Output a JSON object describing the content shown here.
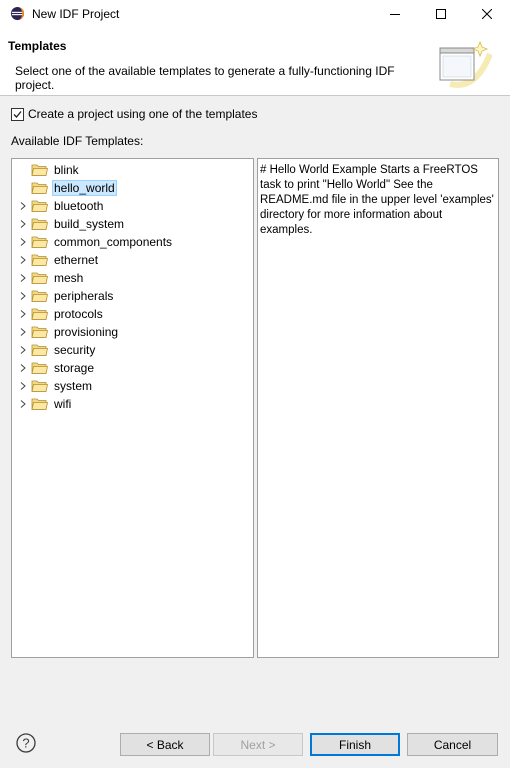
{
  "window": {
    "title": "New IDF Project"
  },
  "header": {
    "title": "Templates",
    "description": "Select one of the available templates to generate a fully-functioning IDF project."
  },
  "checkbox": {
    "label": "Create a project using one of the templates",
    "checked": true
  },
  "available_label": "Available IDF Templates:",
  "tree": {
    "items": [
      {
        "label": "blink",
        "expandable": false,
        "selected": false
      },
      {
        "label": "hello_world",
        "expandable": false,
        "selected": true
      },
      {
        "label": "bluetooth",
        "expandable": true,
        "selected": false
      },
      {
        "label": "build_system",
        "expandable": true,
        "selected": false
      },
      {
        "label": "common_components",
        "expandable": true,
        "selected": false
      },
      {
        "label": "ethernet",
        "expandable": true,
        "selected": false
      },
      {
        "label": "mesh",
        "expandable": true,
        "selected": false
      },
      {
        "label": "peripherals",
        "expandable": true,
        "selected": false
      },
      {
        "label": "protocols",
        "expandable": true,
        "selected": false
      },
      {
        "label": "provisioning",
        "expandable": true,
        "selected": false
      },
      {
        "label": "security",
        "expandable": true,
        "selected": false
      },
      {
        "label": "storage",
        "expandable": true,
        "selected": false
      },
      {
        "label": "system",
        "expandable": true,
        "selected": false
      },
      {
        "label": "wifi",
        "expandable": true,
        "selected": false
      }
    ]
  },
  "description_panel": {
    "text": "# Hello World Example Starts a FreeRTOS task to print \"Hello World\" See the README.md file in the upper level 'examples' directory for more information about examples."
  },
  "buttons": {
    "back": "< Back",
    "next": "Next >",
    "finish": "Finish",
    "cancel": "Cancel"
  },
  "icons": {
    "app": "eclipse-icon",
    "help": "help-icon",
    "folder": "folder-icon",
    "chevron": "chevron-right-icon"
  },
  "colors": {
    "selection_bg": "#cce8ff",
    "selection_border": "#99d1ff",
    "default_button_border": "#0078d7"
  }
}
